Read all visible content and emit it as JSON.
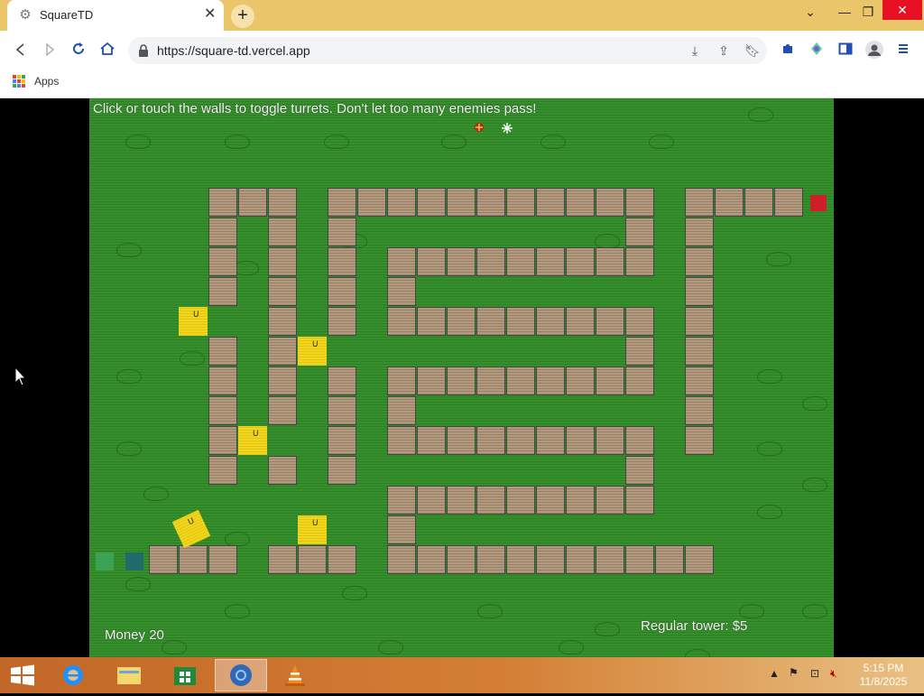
{
  "browser": {
    "tab_title": "SquareTD",
    "tab_icon": "gear-icon",
    "url": "https://square-td.vercel.app",
    "bookmarks_apps_label": "Apps"
  },
  "game": {
    "instructions": "Click or touch the walls to toggle turrets. Don't let too many enemies pass!",
    "money_label": "Money 20",
    "tower_label": "Regular tower: $5",
    "turret_mark": "ᑌ",
    "colors": {
      "grass": "#2f8a25",
      "wall": "#b39a7e",
      "turret": "#f2d61c",
      "goal": "#cc1f2a",
      "spawn": "#2e7d5b"
    }
  },
  "taskbar": {
    "time": "5:15 PM",
    "date": "11/8/2025"
  }
}
